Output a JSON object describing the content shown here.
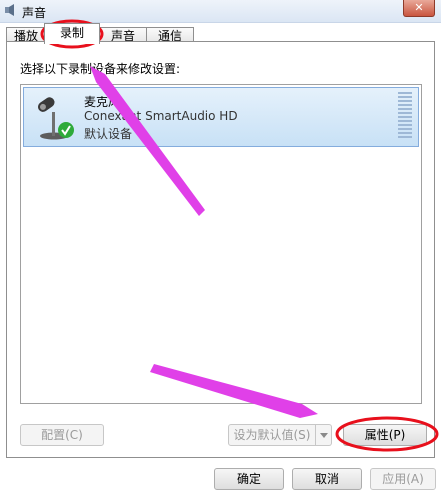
{
  "window": {
    "title": "声音",
    "close_glyph": "✕"
  },
  "tabs": [
    {
      "label": "播放",
      "active": false
    },
    {
      "label": "录制",
      "active": true
    },
    {
      "label": "声音",
      "active": false
    },
    {
      "label": "通信",
      "active": false
    }
  ],
  "instruction": "选择以下录制设备来修改设置:",
  "devices": [
    {
      "name": "麦克风",
      "driver": "Conexant SmartAudio HD",
      "status": "默认设备",
      "selected": true,
      "icon": "microphone-icon",
      "badge": "green-check-icon"
    }
  ],
  "buttons": {
    "configure": "配置(C)",
    "set_default": "设为默认值(S)",
    "properties": "属性(P)",
    "ok": "确定",
    "cancel": "取消",
    "apply": "应用(A)"
  },
  "colors": {
    "annotation_circle": "#e8101c",
    "annotation_arrow": "#e040e8",
    "selection": "#c8e1f6"
  }
}
